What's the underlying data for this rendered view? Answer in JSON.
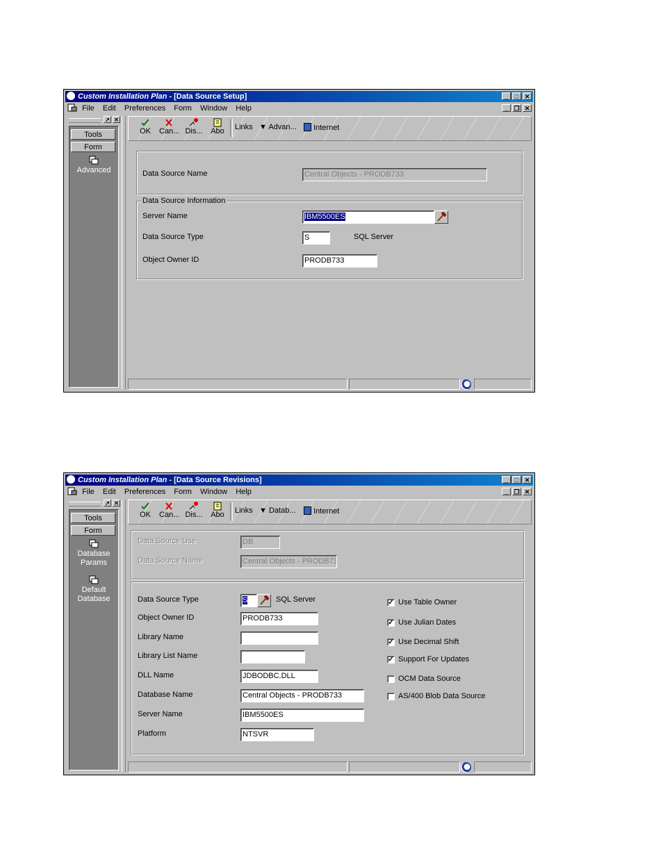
{
  "window1": {
    "title_app": "Custom Installation Plan",
    "title_form": " - [Data Source Setup]",
    "menu": [
      "File",
      "Edit",
      "Preferences",
      "Form",
      "Window",
      "Help"
    ],
    "left_buttons": [
      "Tools",
      "Form"
    ],
    "left_items": [
      "Advanced"
    ],
    "toolbar": {
      "ok": "OK",
      "cancel": "Can...",
      "display": "Dis...",
      "about": "Abo",
      "links": "Links",
      "row_exit": "Advan...",
      "internet": "Internet"
    },
    "data_source_name_label": "Data Source Name",
    "data_source_name_value": "Central Objects - PRODB733",
    "group_title": "Data Source Information",
    "server_name_label": "Server Name",
    "server_name_value": "IBM5500ES",
    "data_source_type_label": "Data Source Type",
    "data_source_type_value": "S",
    "data_source_type_desc": "SQL Server",
    "object_owner_label": "Object Owner ID",
    "object_owner_value": "PRODB733"
  },
  "window2": {
    "title_app": "Custom Installation Plan",
    "title_form": " - [Data Source Revisions]",
    "menu": [
      "File",
      "Edit",
      "Preferences",
      "Form",
      "Window",
      "Help"
    ],
    "left_buttons": [
      "Tools",
      "Form"
    ],
    "left_items": [
      "Database Params",
      "Default Database"
    ],
    "toolbar": {
      "ok": "OK",
      "cancel": "Can...",
      "display": "Dis...",
      "about": "Abo",
      "links": "Links",
      "row_exit": "Datab...",
      "internet": "Internet"
    },
    "data_source_use_label": "Data Source Use",
    "data_source_use_value": "DB",
    "data_source_name_label": "Data Source Name",
    "data_source_name_value": "Central Objects - PRODB73",
    "fields": [
      {
        "label": "Data Source Type",
        "value": "S",
        "desc": "SQL Server"
      },
      {
        "label": "Object Owner ID",
        "value": "PRODB733"
      },
      {
        "label": "Library Name",
        "value": ""
      },
      {
        "label": "Library List Name",
        "value": ""
      },
      {
        "label": "DLL Name",
        "value": "JDBODBC.DLL"
      },
      {
        "label": "Database Name",
        "value": "Central Objects - PRODB733"
      },
      {
        "label": "Server Name",
        "value": "IBM5500ES"
      },
      {
        "label": "Platform",
        "value": "NTSVR"
      }
    ],
    "checkboxes": [
      {
        "label": "Use Table Owner",
        "checked": true
      },
      {
        "label": "Use Julian Dates",
        "checked": true
      },
      {
        "label": "Use Decimal Shift",
        "checked": true
      },
      {
        "label": "Support For Updates",
        "checked": true
      },
      {
        "label": "OCM Data Source",
        "checked": false
      },
      {
        "label": "AS/400 Blob Data Source",
        "checked": false
      }
    ]
  }
}
